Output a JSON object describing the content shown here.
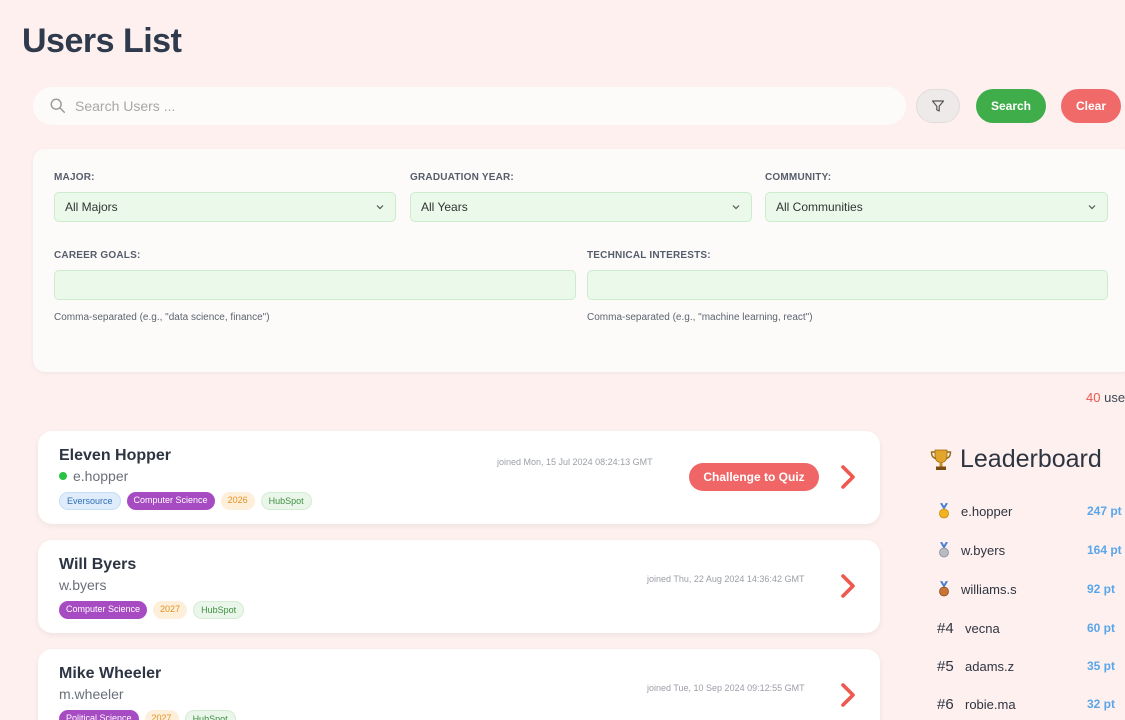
{
  "page_title": "Users List",
  "search": {
    "placeholder": "Search Users ...",
    "value": ""
  },
  "buttons": {
    "search_label": "Search",
    "clear_label": "Clear"
  },
  "filters": {
    "major_label": "MAJOR:",
    "major_value": "All Majors",
    "grad_label": "GRADUATION YEAR:",
    "grad_value": "All Years",
    "community_label": "COMMUNITY:",
    "community_value": "All Communities",
    "career_label": "CAREER GOALS:",
    "career_value": "",
    "career_hint": "Comma-separated (e.g., \"data science, finance\")",
    "tech_label": "TECHNICAL INTERESTS:",
    "tech_value": "",
    "tech_hint": "Comma-separated (e.g., \"machine learning, react\")"
  },
  "users_count": {
    "number": "40",
    "suffix": "use"
  },
  "users": [
    {
      "name": "Eleven Hopper",
      "handle": "e.hopper",
      "online": true,
      "joined": "joined Mon, 15 Jul 2024 08:24:13 GMT",
      "tags": {
        "community": "Eversource",
        "major": "Computer Science",
        "year": "2026",
        "company": "HubSpot"
      },
      "action_label": "Challenge to Quiz"
    },
    {
      "name": "Will Byers",
      "handle": "w.byers",
      "online": false,
      "joined": "joined Thu, 22 Aug 2024 14:36:42 GMT",
      "tags": {
        "major": "Computer Science",
        "year": "2027",
        "company": "HubSpot"
      }
    },
    {
      "name": "Mike Wheeler",
      "handle": "m.wheeler",
      "online": false,
      "joined": "joined Tue, 10 Sep 2024 09:12:55 GMT",
      "tags": {
        "major": "Political Science",
        "year": "2027",
        "company": "HubSpot"
      }
    }
  ],
  "leaderboard": {
    "title": "Leaderboard",
    "entries": [
      {
        "rank": "",
        "medal": "gold-medal-icon",
        "user": "e.hopper",
        "points": "247 pt"
      },
      {
        "rank": "",
        "medal": "silver-medal-icon",
        "user": "w.byers",
        "points": "164 pt"
      },
      {
        "rank": "",
        "medal": "bronze-medal-icon",
        "user": "williams.s",
        "points": "92 pt"
      },
      {
        "rank": "#4",
        "medal": "",
        "user": "vecna",
        "points": "60 pt"
      },
      {
        "rank": "#5",
        "medal": "",
        "user": "adams.z",
        "points": "35 pt"
      },
      {
        "rank": "#6",
        "medal": "",
        "user": "robie.ma",
        "points": "32 pt"
      }
    ]
  },
  "colors": {
    "background": "#fdf0ee",
    "search_green": "#3fae4a",
    "clear_red": "#f16a6a",
    "major_tag": "#a74bc2",
    "points_blue": "#5aa6ea"
  }
}
